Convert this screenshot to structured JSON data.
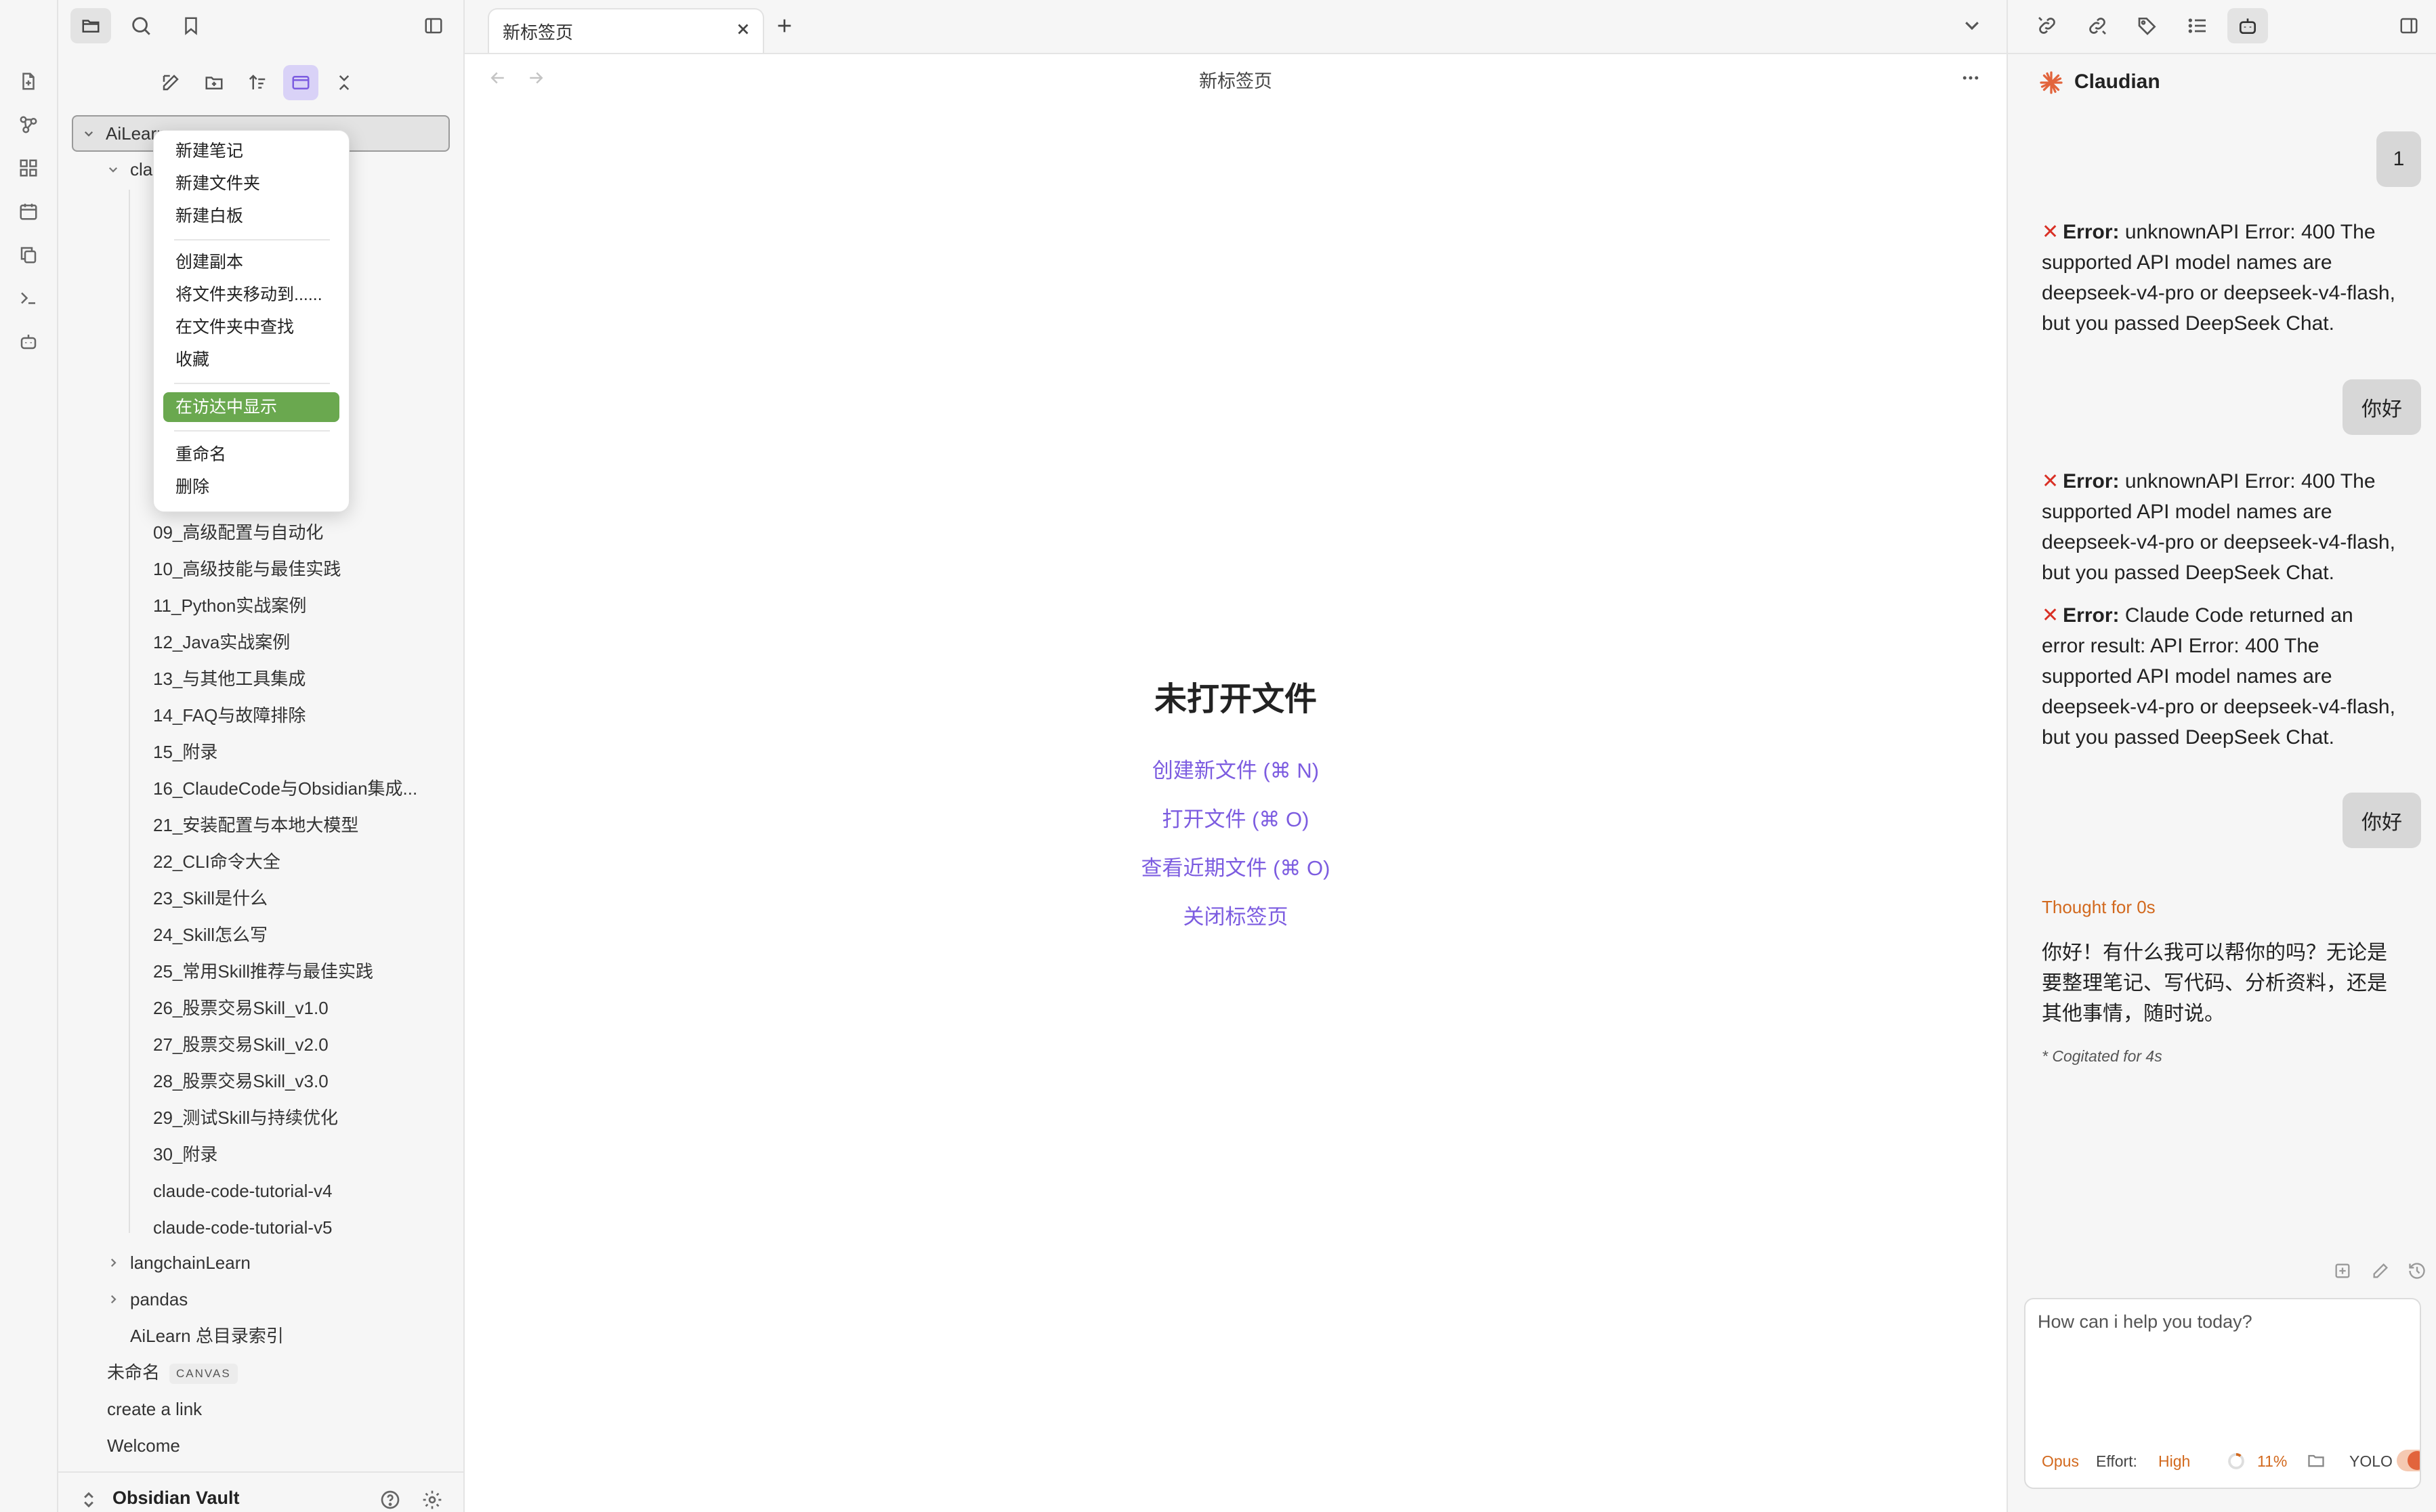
{
  "colors": {
    "accent_purple": "#7c5ce0",
    "menu_highlight": "#6aa84f",
    "error_red": "#d93025",
    "orange": "#d2691e",
    "claudian_logo": "#e2643c"
  },
  "ribbon": {
    "icons": [
      "file-plus-icon",
      "graph-icon",
      "grid-icon",
      "calendar-icon",
      "copy-icon",
      "terminal-icon",
      "bot-icon"
    ]
  },
  "sidebar": {
    "tree": {
      "root": "AiLearn",
      "sub_folder": "cla",
      "items": [
        "09_高级配置与自动化",
        "10_高级技能与最佳实践",
        "11_Python实战案例",
        "12_Java实战案例",
        "13_与其他工具集成",
        "14_FAQ与故障排除",
        "15_附录",
        "16_ClaudeCode与Obsidian集成...",
        "21_安装配置与本地大模型",
        "22_CLI命令大全",
        "23_Skill是什么",
        "24_Skill怎么写",
        "25_常用Skill推荐与最佳实践",
        "26_股票交易Skill_v1.0",
        "27_股票交易Skill_v2.0",
        "28_股票交易Skill_v3.0",
        "29_测试Skill与持续优化",
        "30_附录",
        "claude-code-tutorial-v4",
        "claude-code-tutorial-v5"
      ],
      "folders": [
        "langchainLearn",
        "pandas"
      ],
      "index_file": "AiLearn 总目录索引",
      "untitled": "未命名",
      "canvas_badge": "CANVAS",
      "create_link": "create a link",
      "welcome": "Welcome"
    },
    "vault_name": "Obsidian Vault"
  },
  "context_menu": {
    "items": [
      "新建笔记",
      "新建文件夹",
      "新建白板",
      "创建副本",
      "将文件夹移动到......",
      "在文件夹中查找",
      "收藏",
      "在访达中显示",
      "重命名",
      "删除"
    ]
  },
  "main": {
    "tab_title": "新标签页",
    "header_title": "新标签页",
    "empty_title": "未打开文件",
    "links": [
      "创建新文件 (⌘ N)",
      "打开文件 (⌘ O)",
      "查看近期文件 (⌘ O)",
      "关闭标签页"
    ]
  },
  "right_panel": {
    "title": "Claudian",
    "user_msg_1": "1",
    "error_label": "Error:",
    "error_1": "unknownAPI Error: 400 The supported API model names are deepseek-v4-pro or deepseek-v4-flash, but you passed DeepSeek Chat.",
    "user_msg_2": "你好",
    "error_2": "unknownAPI Error: 400 The supported API model names are deepseek-v4-pro or deepseek-v4-flash, but you passed DeepSeek Chat.",
    "error_3": "Claude Code returned an error result: API Error: 400 The supported API model names are deepseek-v4-pro or deepseek-v4-flash, but you passed DeepSeek Chat.",
    "user_msg_3": "你好",
    "thought": "Thought for 0s",
    "reply": "你好！有什么我可以帮你的吗？无论是要整理笔记、写代码、分析资料，还是其他事情，随时说。",
    "cogitated": "* Cogitated for 4s",
    "input_placeholder": "How can i help you today?",
    "model": "Opus",
    "effort_label": "Effort:",
    "effort_value": "High",
    "context_pct": "11%",
    "context_fraction": 0.11,
    "yolo_label": "YOLO"
  }
}
